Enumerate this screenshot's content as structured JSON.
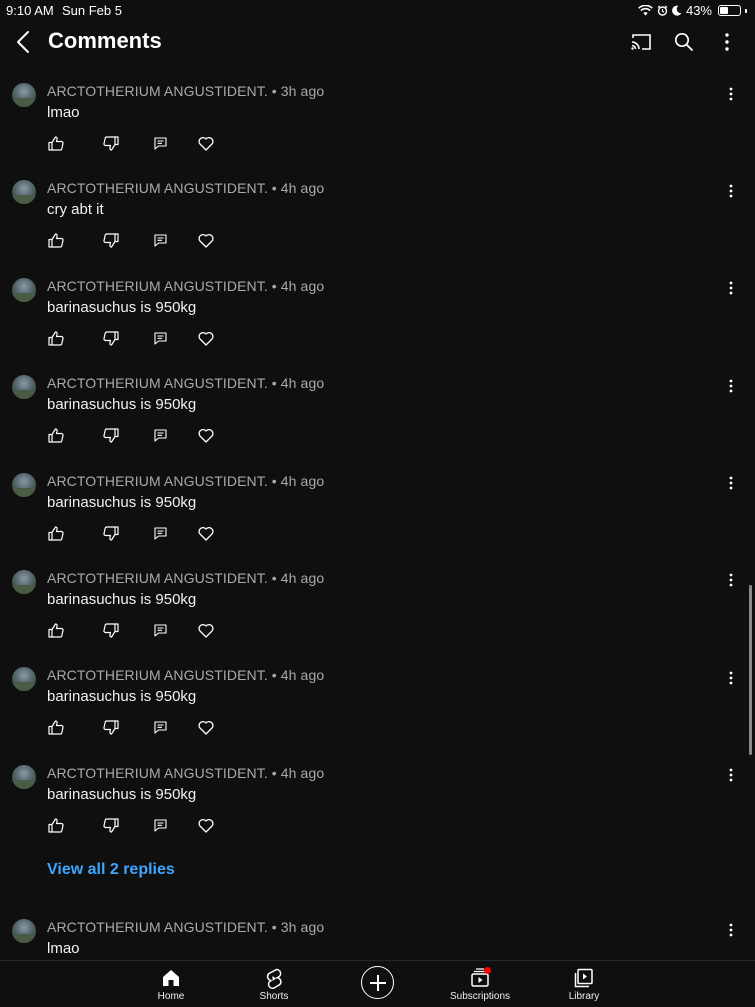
{
  "status_bar": {
    "time": "9:10 AM",
    "date": "Sun Feb 5",
    "battery": "43%",
    "battery_level": 0.43
  },
  "header": {
    "title": "Comments"
  },
  "comments": [
    {
      "author": "ARCTOTHERIUM ANGUSTIDENT.",
      "age": "3h ago",
      "text": "lmao"
    },
    {
      "author": "ARCTOTHERIUM ANGUSTIDENT.",
      "age": "4h ago",
      "text": "cry abt it"
    },
    {
      "author": "ARCTOTHERIUM ANGUSTIDENT.",
      "age": "4h ago",
      "text": "barinasuchus is 950kg"
    },
    {
      "author": "ARCTOTHERIUM ANGUSTIDENT.",
      "age": "4h ago",
      "text": "barinasuchus is 950kg"
    },
    {
      "author": "ARCTOTHERIUM ANGUSTIDENT.",
      "age": "4h ago",
      "text": "barinasuchus is 950kg"
    },
    {
      "author": "ARCTOTHERIUM ANGUSTIDENT.",
      "age": "4h ago",
      "text": "barinasuchus is 950kg"
    },
    {
      "author": "ARCTOTHERIUM ANGUSTIDENT.",
      "age": "4h ago",
      "text": "barinasuchus is 950kg"
    },
    {
      "author": "ARCTOTHERIUM ANGUSTIDENT.",
      "age": "4h ago",
      "text": "barinasuchus is 950kg"
    },
    {
      "author": "ARCTOTHERIUM ANGUSTIDENT.",
      "age": "3h ago",
      "text": "lmao"
    }
  ],
  "view_replies": "View all 2 replies",
  "bottom_nav": {
    "home": "Home",
    "shorts": "Shorts",
    "subscriptions": "Subscriptions",
    "library": "Library"
  },
  "colors": {
    "background": "#0f0f0f",
    "link": "#3ea6ff",
    "meta": "#aaaaaa",
    "notification_dot": "#ff0000"
  },
  "icons": [
    "back-icon",
    "cast-icon",
    "search-icon",
    "more-vertical-icon",
    "thumbs-up-icon",
    "thumbs-down-icon",
    "reply-icon",
    "heart-icon",
    "home-icon",
    "shorts-icon",
    "create-icon",
    "subscriptions-icon",
    "library-icon"
  ]
}
